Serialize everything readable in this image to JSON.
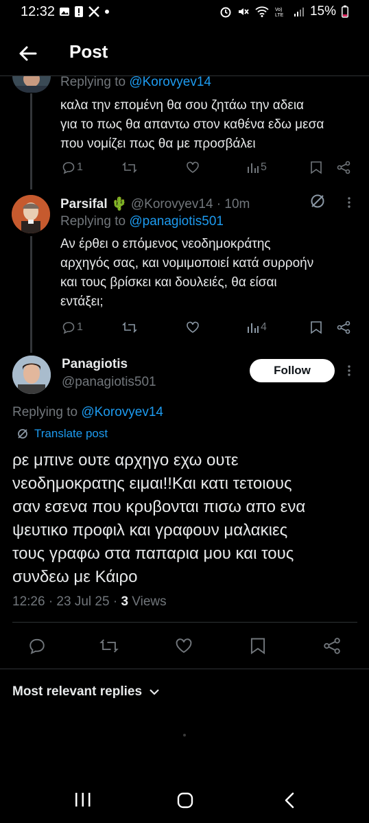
{
  "status_bar": {
    "time": "12:32",
    "battery": "15%",
    "notification_icons": [
      "gallery-icon",
      "alert-icon",
      "x-logo-icon",
      "dot-icon"
    ],
    "system_icons": [
      "alarm-icon",
      "mute-icon",
      "wifi-icon",
      "volte-icon",
      "signal-icon",
      "battery-icon"
    ]
  },
  "header": {
    "title": "Post"
  },
  "reply1": {
    "replying_label": "Replying to",
    "replying_to": "@Korovyev14",
    "text_lines": [
      "καλα την επομένη θα σου ζητάω την αδεια",
      "για το πως θα απαντω στον καθένα εδω μεσα",
      "που νομίζει πως θα με προσβάλει"
    ],
    "reply_count": "1",
    "views": "5"
  },
  "reply2": {
    "name": "Parsifal",
    "name_emoji": "🌵",
    "handle": "@Korovyev14",
    "time": "· 10m",
    "replying_label": "Replying to",
    "replying_to": "@panagiotis501",
    "text_lines": [
      "Αν έρθει ο επόμενος νεοδημοκράτης",
      "αρχηγός σας, και νομιμοποιεί κατά συρροήν",
      "και τους βρίσκει και δουλειές, θα είσαι",
      "εντάξει;"
    ],
    "reply_count": "1",
    "views": "4"
  },
  "main_post": {
    "name": "Panagiotis",
    "handle": "@panagiotis501",
    "follow_label": "Follow",
    "replying_label": "Replying to",
    "replying_to": "@Korovyev14",
    "translate_label": "Translate post",
    "text_lines": [
      "ρε μπινε ουτε αρχηγο εχω ουτε",
      "νεοδημοκρατης ειμαι!!Και κατι τετοιους",
      "σαν εσενα που κρυβονται πισω απο ενα",
      "ψευτικο προφιλ και γραφουν μαλακιες",
      "τους γραφω στα παπαρια μου και τους",
      "συνδεω με Κάιρο"
    ],
    "timestamp": "12:26 · 23 Jul 25 ·",
    "views_count": "3",
    "views_label": "Views"
  },
  "replies_sort": {
    "label": "Most relevant replies"
  },
  "colors": {
    "accent": "#1d9bf0",
    "background": "#000000",
    "muted": "#71767b",
    "divider": "#2f3336"
  }
}
